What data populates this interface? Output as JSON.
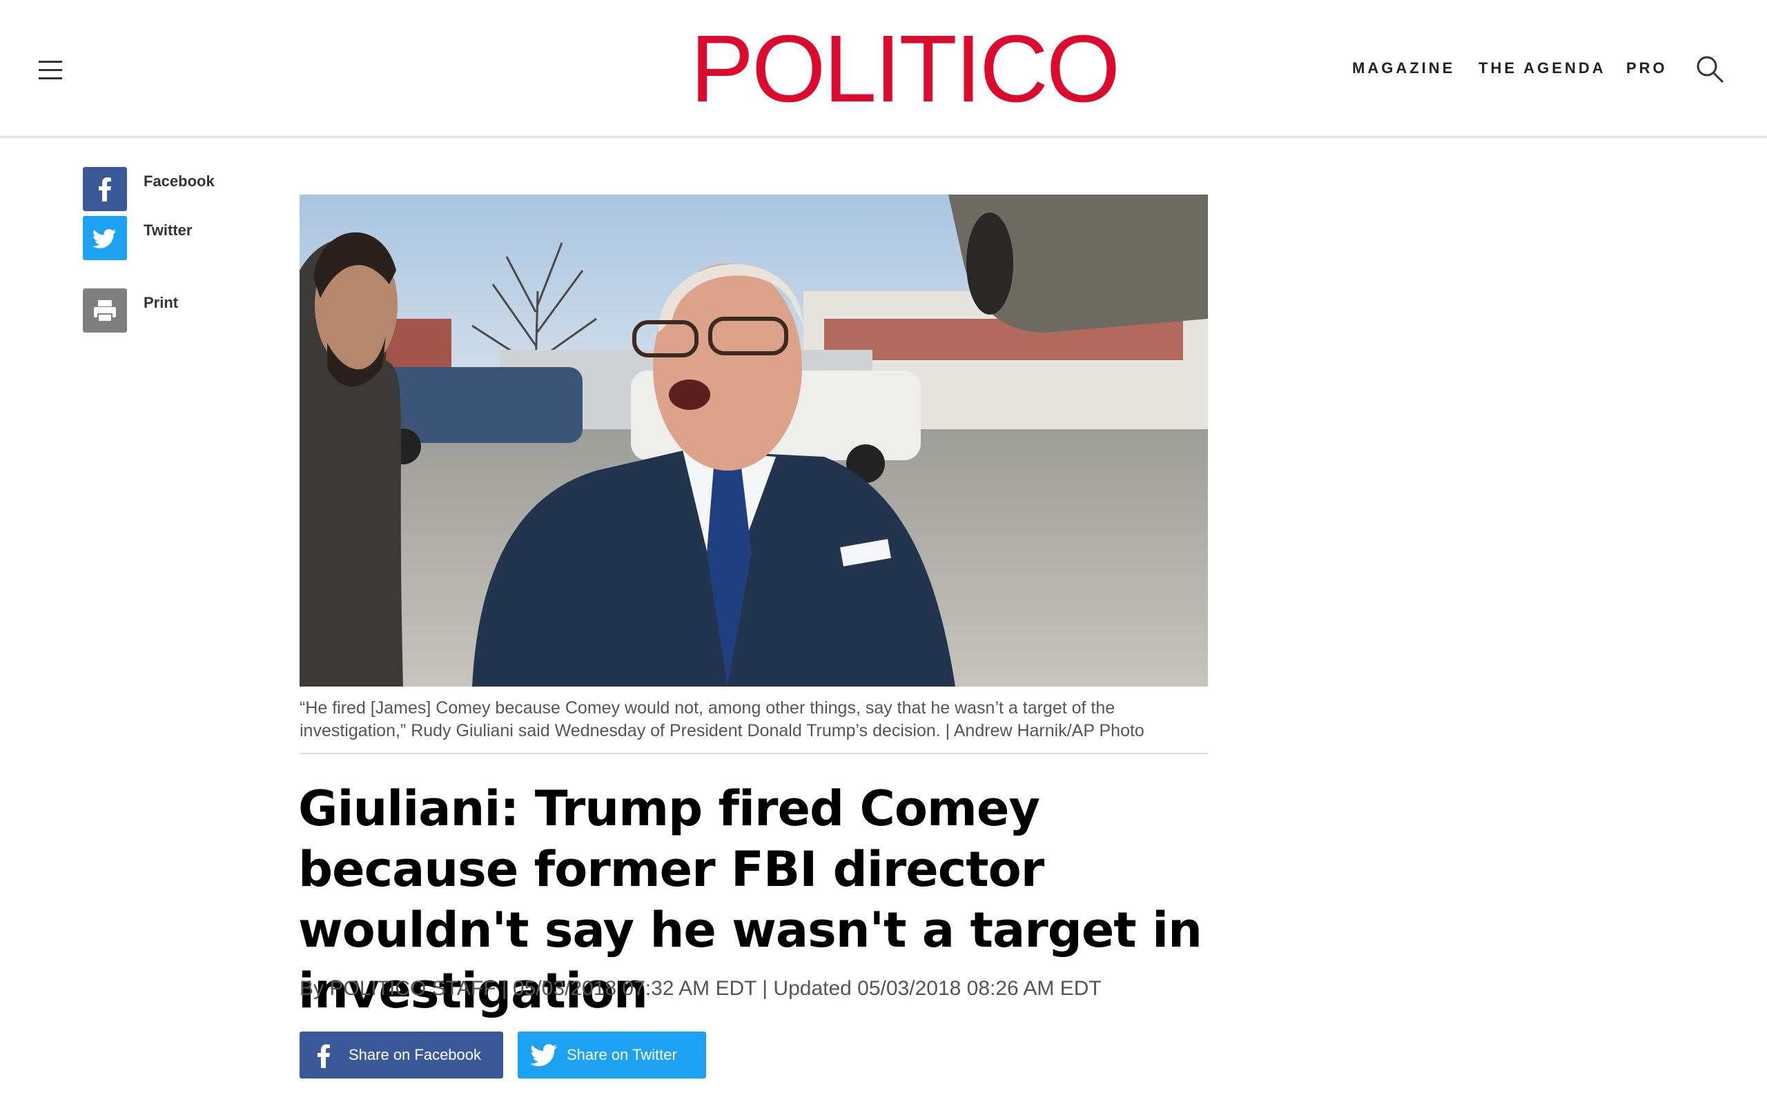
{
  "header": {
    "logo": "POLITICO",
    "nav": [
      "MAGAZINE",
      "THE AGENDA",
      "PRO"
    ],
    "colors": {
      "brand": "#dc0a2d",
      "facebook": "#3b5998",
      "twitter": "#1da1f2",
      "print": "#7f7f7f"
    }
  },
  "rail": {
    "facebook_label": "Facebook",
    "twitter_label": "Twitter",
    "print_label": "Print"
  },
  "article": {
    "caption": "“He fired [James] Comey because Comey would not, among other things, say that he wasn’t a target of the investigation,” Rudy Giuliani said Wednesday of President Donald Trump’s decision. | Andrew Harnik/AP Photo",
    "headline": "Giuliani: Trump fired Comey because former FBI director wouldn't say he wasn't a target in investigation",
    "byline": "By POLITICO STAFF | 05/03/2018 07:32 AM EDT | Updated 05/03/2018 08:26 AM EDT"
  },
  "share": {
    "facebook_label": "Share on Facebook",
    "twitter_label": "Share on Twitter"
  }
}
